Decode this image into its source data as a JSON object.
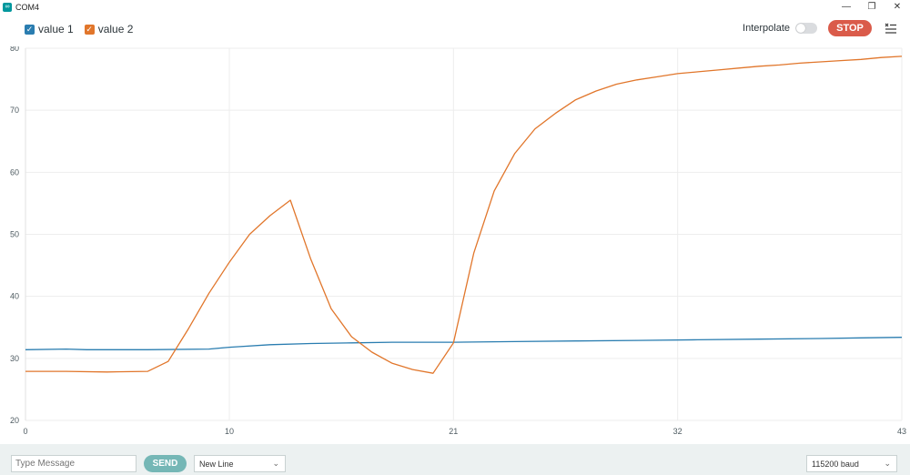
{
  "window": {
    "title": "COM4",
    "icon": "arduino-icon"
  },
  "toolbar": {
    "interpolate_label": "Interpolate",
    "stop_label": "STOP"
  },
  "legend": [
    {
      "label": "value 1",
      "color": "#2a7db0"
    },
    {
      "label": "value 2",
      "color": "#e1762b"
    }
  ],
  "footer": {
    "message_placeholder": "Type Message",
    "send_label": "SEND",
    "line_ending": "New Line",
    "baud": "115200 baud"
  },
  "chart_data": {
    "type": "line",
    "xlim": [
      0,
      43
    ],
    "ylim": [
      20,
      80
    ],
    "x_ticks": [
      0,
      10,
      21,
      32,
      43
    ],
    "y_ticks": [
      20,
      30,
      40,
      50,
      60,
      70,
      80
    ],
    "grid": true,
    "series": [
      {
        "name": "value 1",
        "color": "#2a7db0",
        "x": [
          0,
          2,
          3,
          6,
          9,
          10,
          12,
          14,
          16,
          18,
          21,
          24,
          27,
          30,
          33,
          36,
          39,
          41,
          43
        ],
        "y": [
          31.4,
          31.5,
          31.4,
          31.4,
          31.5,
          31.8,
          32.2,
          32.4,
          32.5,
          32.6,
          32.6,
          32.7,
          32.8,
          32.9,
          33,
          33.1,
          33.2,
          33.3,
          33.4
        ]
      },
      {
        "name": "value 2",
        "color": "#e1762b",
        "x": [
          0,
          2,
          4,
          6,
          7,
          8,
          9,
          10,
          11,
          12,
          13,
          14,
          15,
          16,
          17,
          18,
          19,
          20,
          21,
          22,
          23,
          24,
          25,
          26,
          27,
          28,
          29,
          30,
          31,
          32,
          33,
          34,
          35,
          36,
          37,
          38,
          39,
          40,
          41,
          42,
          43
        ],
        "y": [
          27.9,
          27.9,
          27.8,
          27.9,
          29.5,
          34.8,
          40.5,
          45.5,
          50,
          53,
          55.5,
          46,
          38,
          33.5,
          31,
          29.2,
          28.2,
          27.6,
          32.5,
          47,
          57,
          63,
          67,
          69.5,
          71.7,
          73.1,
          74.2,
          74.9,
          75.4,
          75.9,
          76.2,
          76.5,
          76.8,
          77.1,
          77.3,
          77.6,
          77.8,
          78,
          78.2,
          78.5,
          78.7
        ]
      }
    ]
  }
}
